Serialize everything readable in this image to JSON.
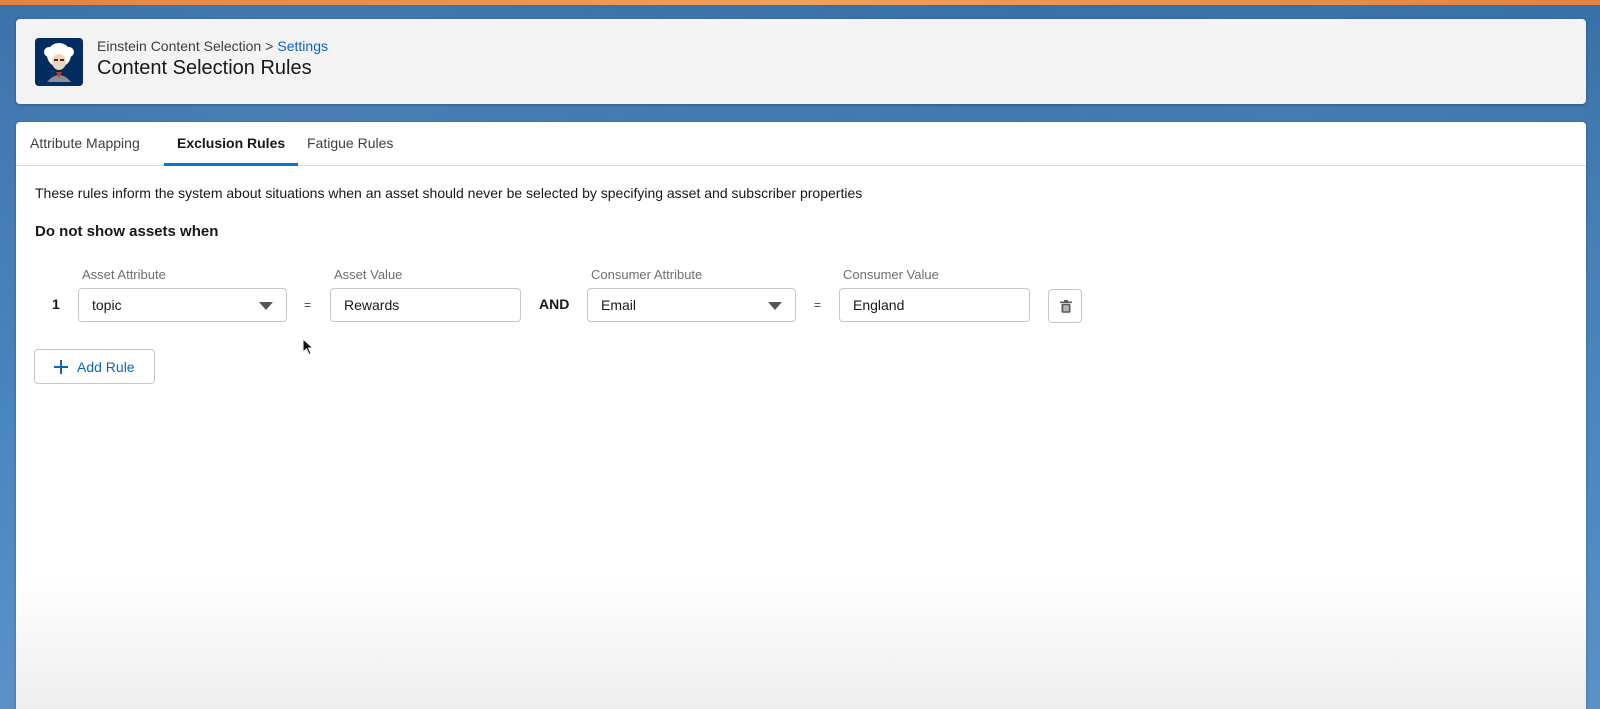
{
  "header": {
    "breadcrumb_app": "Einstein Content Selection",
    "breadcrumb_separator": ">",
    "breadcrumb_link": "Settings",
    "title": "Content Selection Rules",
    "icon": "einstein-avatar-icon"
  },
  "tabs": [
    {
      "label": "Attribute Mapping",
      "active": false
    },
    {
      "label": "Exclusion Rules",
      "active": true
    },
    {
      "label": "Fatigue Rules",
      "active": false
    }
  ],
  "content": {
    "description": "These rules inform the system about situations when an asset should never be selected by specifying asset and subscriber properties",
    "section_heading": "Do not show assets when"
  },
  "columns": {
    "asset_attribute": "Asset Attribute",
    "asset_value": "Asset Value",
    "consumer_attribute": "Consumer Attribute",
    "consumer_value": "Consumer Value"
  },
  "rules": [
    {
      "number": "1",
      "asset_attribute": "topic",
      "operator1": "=",
      "asset_value": "Rewards",
      "conjunction": "AND",
      "consumer_attribute": "Email",
      "operator2": "=",
      "consumer_value": "England"
    }
  ],
  "actions": {
    "add_rule_label": "Add Rule",
    "delete_icon": "trash-icon"
  },
  "colors": {
    "accent": "#0176d3",
    "link": "#0b63c4",
    "brand_stripe": "#e2833f",
    "icon_bg": "#032d60"
  }
}
